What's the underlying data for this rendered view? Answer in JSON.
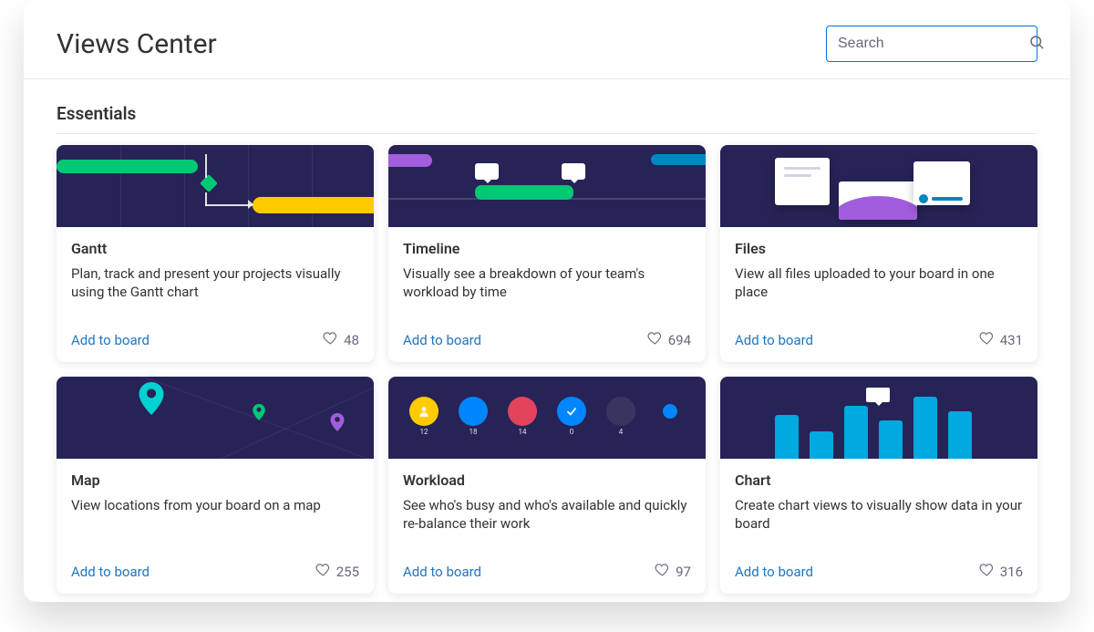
{
  "header": {
    "title": "Views Center",
    "search_placeholder": "Search"
  },
  "section": {
    "title": "Essentials"
  },
  "action_label": "Add to board",
  "cards": [
    {
      "title": "Gantt",
      "desc": "Plan, track and present your projects visually using the Gantt chart",
      "likes": "48"
    },
    {
      "title": "Timeline",
      "desc": "Visually see a breakdown of your team's workload by time",
      "likes": "694"
    },
    {
      "title": "Files",
      "desc": "View all files uploaded to your board in one place",
      "likes": "431"
    },
    {
      "title": "Map",
      "desc": "View locations from your board on a map",
      "likes": "255"
    },
    {
      "title": "Workload",
      "desc": "See who's busy and who's available and quickly re-balance their work",
      "likes": "97"
    },
    {
      "title": "Chart",
      "desc": "Create chart views to visually show data in your board",
      "likes": "316"
    }
  ],
  "workload_counts": [
    "12",
    "18",
    "14",
    "0",
    "4"
  ]
}
